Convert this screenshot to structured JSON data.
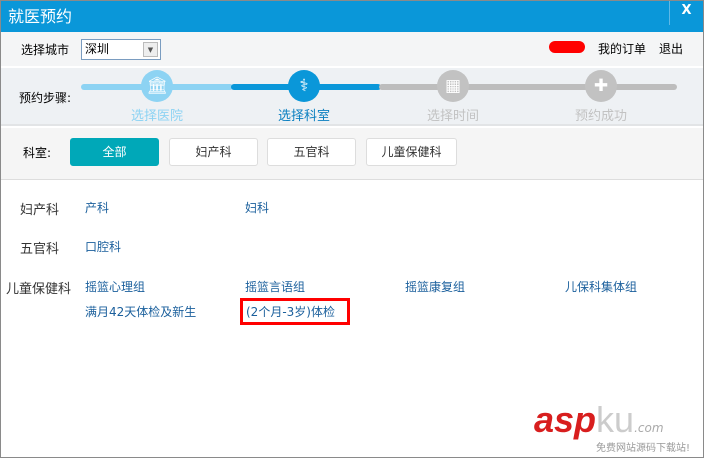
{
  "window": {
    "title": "就医预约",
    "close_label": "X"
  },
  "header": {
    "city_label": "选择城市",
    "city_value": "深圳",
    "orders": "我的订单",
    "logout": "退出"
  },
  "steps": {
    "label": "预约步骤:",
    "items": [
      {
        "label": "选择医院",
        "icon": "hospital-icon",
        "state": "done"
      },
      {
        "label": "选择科室",
        "icon": "stethoscope-icon",
        "state": "current"
      },
      {
        "label": "选择时间",
        "icon": "calendar-icon",
        "state": "pending"
      },
      {
        "label": "预约成功",
        "icon": "badge-icon",
        "state": "pending"
      }
    ]
  },
  "filter": {
    "label": "科室:",
    "buttons": [
      "全部",
      "妇产科",
      "五官科",
      "儿童保健科"
    ],
    "active": 0
  },
  "departments": [
    {
      "name": "妇产科",
      "items": [
        "产科",
        "妇科"
      ]
    },
    {
      "name": "五官科",
      "items": [
        "口腔科"
      ]
    },
    {
      "name": "儿童保健科",
      "items": [
        "摇篮心理组",
        "摇篮言语组",
        "摇篮康复组",
        "儿保科集体组",
        "满月42天体检及新生",
        "(2个月-3岁)体检"
      ]
    }
  ],
  "watermark": {
    "brand": "aspku",
    "suffix": ".com",
    "tagline": "免费网站源码下载站!"
  },
  "colors": {
    "title": "#0a97d9",
    "accent": "#00a8b8",
    "link": "#1a5f9c",
    "highlight": "#ff0000"
  }
}
